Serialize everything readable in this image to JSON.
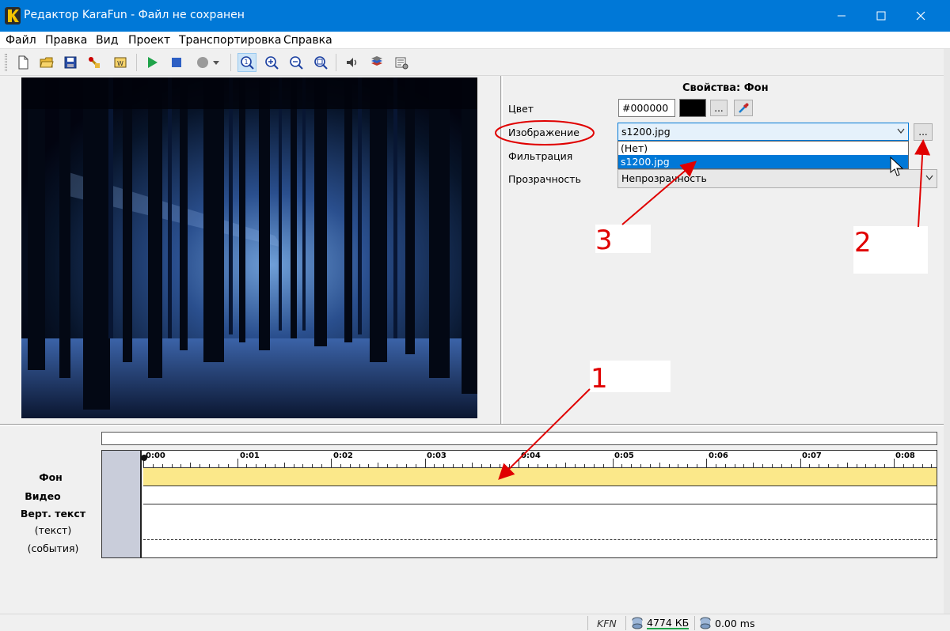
{
  "window": {
    "title": "Редактор KaraFun - Файл не сохранен",
    "minimize_icon": "minimize-icon",
    "maximize_icon": "maximize-icon",
    "close_icon": "close-icon"
  },
  "menu": {
    "items": [
      "Файл",
      "Правка",
      "Вид",
      "Проект",
      "Транспортировка",
      "Справка"
    ]
  },
  "toolbar": {
    "icons": [
      "new-file-icon",
      "open-folder-icon",
      "save-icon",
      "properties-icon",
      "export-icon",
      "play-icon",
      "stop-icon",
      "record-icon",
      "record-dropdown-icon",
      "zoom-1-icon",
      "zoom-in-icon",
      "zoom-out-icon",
      "zoom-fit-icon",
      "audio-sync-icon",
      "layers-icon",
      "settings-icon"
    ]
  },
  "properties": {
    "title": "Свойства: Фон",
    "color_label": "Цвет",
    "color_value": "#000000",
    "color_swatch": "#000000",
    "browse_label": "...",
    "image_label": "Изображение",
    "image_value": "s1200.jpg",
    "image_options": [
      "(Нет)",
      "s1200.jpg"
    ],
    "filter_label": "Фильтрация",
    "opacity_label": "Прозрачность",
    "opacity_value": "Непрозрачность"
  },
  "annotations": {
    "one": "1",
    "two": "2",
    "three": "3",
    "color": "#e00000"
  },
  "timeline": {
    "ticks": [
      "0:00",
      "0:01",
      "0:02",
      "0:03",
      "0:04",
      "0:05",
      "0:06",
      "0:07",
      "0:08"
    ],
    "tracks": {
      "background": "Фон",
      "video": "Видео",
      "vert_text": "Верт. текст",
      "text_sub": "(текст)",
      "events_sub": "(события)"
    },
    "background_track_color": "#fbe88a"
  },
  "status": {
    "kfn": "KFN",
    "size": "4774 КБ",
    "latency": "0.00 ms"
  }
}
